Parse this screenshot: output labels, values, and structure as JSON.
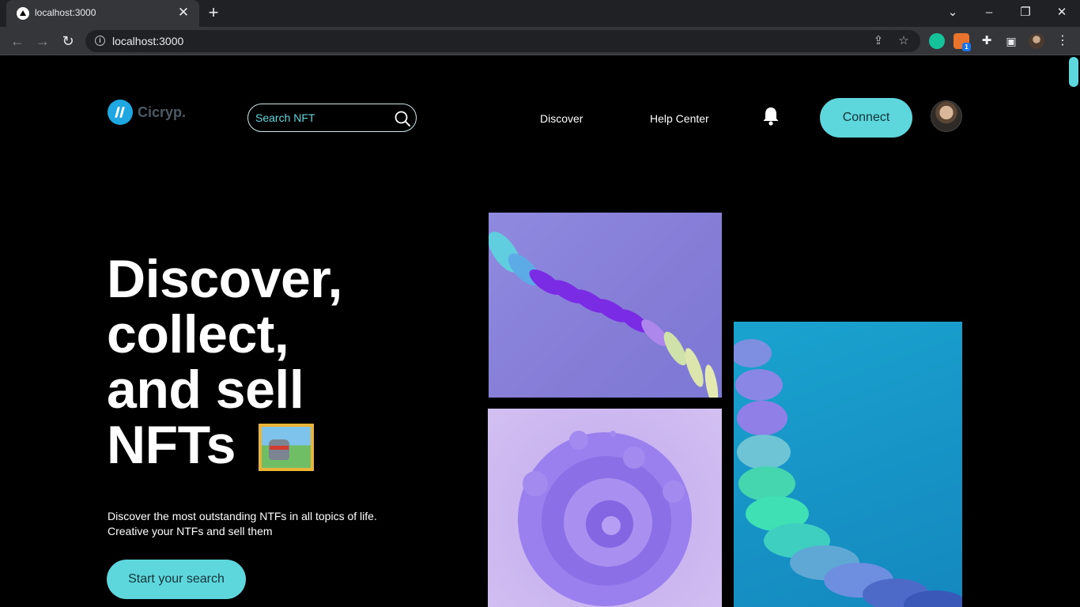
{
  "browser": {
    "tab_title": "localhost:3000",
    "url": "localhost:3000",
    "extension_badge": "1"
  },
  "header": {
    "brand": "Cicryp.",
    "search_placeholder": "Search NFT",
    "nav": [
      "Discover",
      "Help Center"
    ],
    "connect_label": "Connect"
  },
  "hero": {
    "title_lines": [
      "Discover,",
      "collect,",
      "and sell",
      "NFTs"
    ],
    "subtitle_lines": [
      "Discover the most outstanding NTFs in all topics of life.",
      "Creative your NTFs and sell them"
    ],
    "cta_label": "Start your search"
  },
  "colors": {
    "accent": "#5dd6dc",
    "logo": "#1ea7e0",
    "background": "#000000"
  },
  "icons": [
    "search-icon",
    "bell-icon",
    "star-icon",
    "share-icon",
    "extensions-icon",
    "side-panel-icon",
    "menu-icon"
  ]
}
